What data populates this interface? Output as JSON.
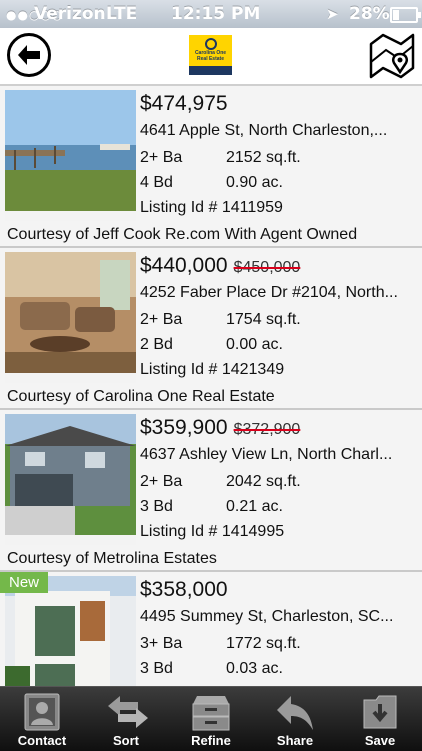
{
  "status_bar": {
    "signal": "●●○○○",
    "carrier": "Verizon",
    "network": "LTE",
    "time": "12:15 PM",
    "battery": "28%"
  },
  "header": {
    "logo_text": "Carolina One Real Estate"
  },
  "listings": [
    {
      "price": "$474,975",
      "old_price": "",
      "address": "4641 Apple St, North Charleston,...",
      "baths": "2+ Ba",
      "sqft": "2152 sq.ft.",
      "beds": "4 Bd",
      "acres": "0.90 ac.",
      "listing_id": "Listing Id # 1411959",
      "courtesy": "Courtesy of Jeff Cook Re.com With Agent Owned",
      "badge": ""
    },
    {
      "price": "$440,000",
      "old_price": "$450,000",
      "address": "4252 Faber Place Dr #2104, North...",
      "baths": "2+ Ba",
      "sqft": "1754 sq.ft.",
      "beds": "2 Bd",
      "acres": "0.00 ac.",
      "listing_id": "Listing Id # 1421349",
      "courtesy": "Courtesy of Carolina One Real Estate",
      "badge": ""
    },
    {
      "price": "$359,900",
      "old_price": "$372,900",
      "address": "4637 Ashley View Ln, North Charl...",
      "baths": "2+ Ba",
      "sqft": "2042 sq.ft.",
      "beds": "3 Bd",
      "acres": "0.21 ac.",
      "listing_id": "Listing Id # 1414995",
      "courtesy": "Courtesy of Metrolina Estates",
      "badge": ""
    },
    {
      "price": "$358,000",
      "old_price": "",
      "address": "4495 Summey St, Charleston, SC...",
      "baths": "3+ Ba",
      "sqft": "1772 sq.ft.",
      "beds": "3 Bd",
      "acres": "0.03 ac.",
      "listing_id": "",
      "courtesy": "",
      "badge": "New"
    }
  ],
  "toolbar": {
    "contact": "Contact",
    "sort": "Sort",
    "refine": "Refine",
    "share": "Share",
    "save": "Save"
  },
  "colors": {
    "toolbar": "#1e1e1e",
    "new_badge": "#74b84a",
    "strike": "#d9001b",
    "logo_yellow": "#ffd400",
    "logo_navy": "#1d3760"
  }
}
